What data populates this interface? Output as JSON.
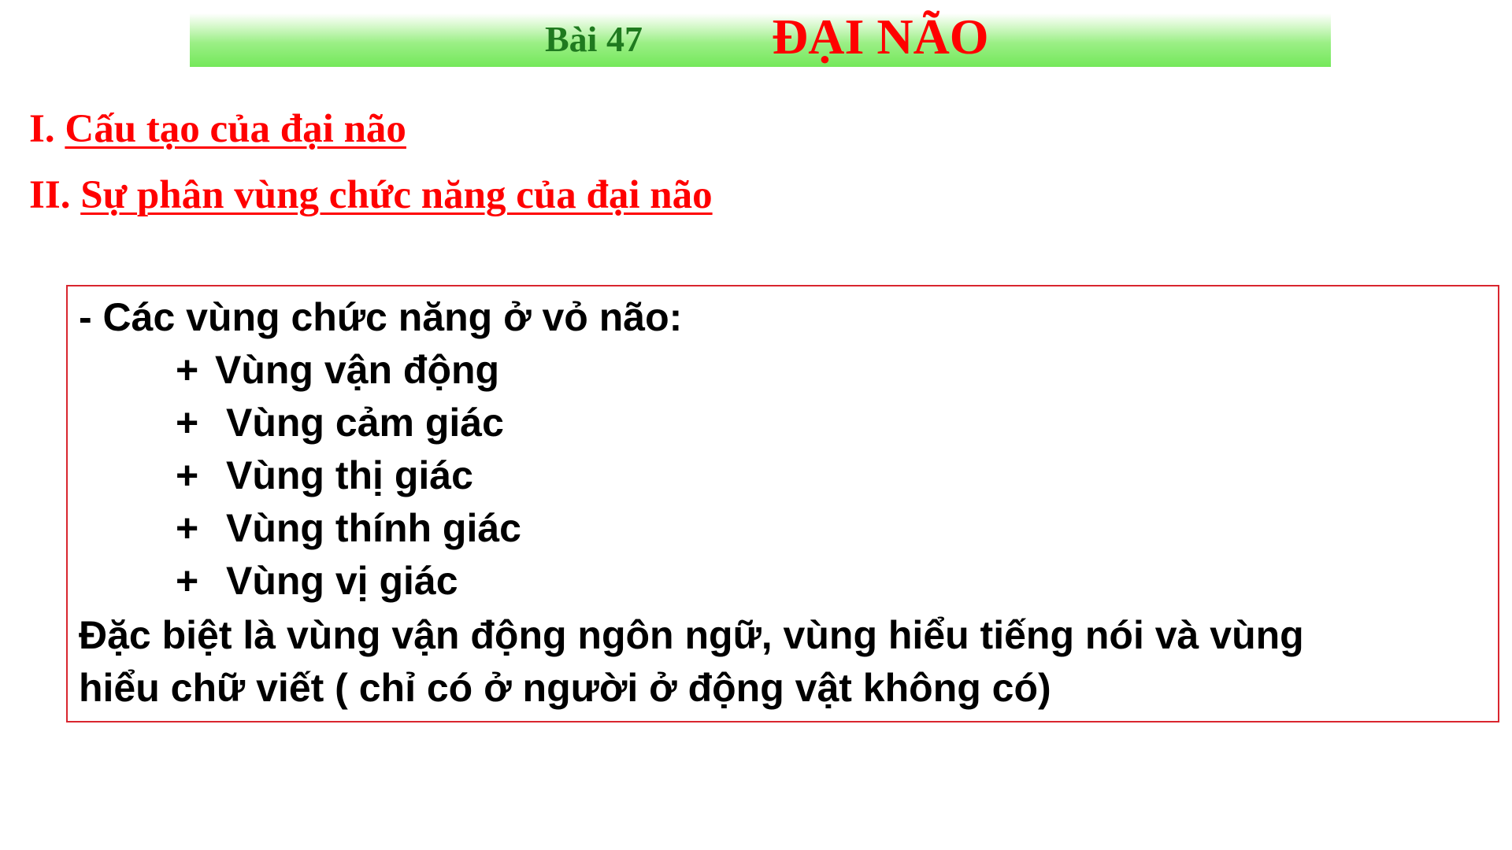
{
  "header": {
    "lesson_number": "Bài 47",
    "title": "ĐẠI NÃO"
  },
  "sections": [
    {
      "numeral": "I.",
      "title": "Cấu tạo của đại não"
    },
    {
      "numeral": "II.",
      "title": "Sự phân vùng chức năng của đại não"
    }
  ],
  "content": {
    "intro": "- Các vùng chức năng ở vỏ não:",
    "bullet_symbol": "+",
    "items": [
      "Vùng vận động",
      "Vùng cảm giác",
      "Vùng thị giác",
      "Vùng thính giác",
      "Vùng vị giác"
    ],
    "note_line_1": "Đặc biệt là vùng vận động ngôn ngữ, vùng hiểu tiếng nói và vùng",
    "note_line_2": "hiểu chữ viết ( chỉ có ở người ở động vật không có)"
  },
  "colors": {
    "title_red": "#ff0000",
    "lesson_green": "#1f7a1f",
    "banner_green": "#74e85a",
    "box_border": "#d9262f"
  }
}
